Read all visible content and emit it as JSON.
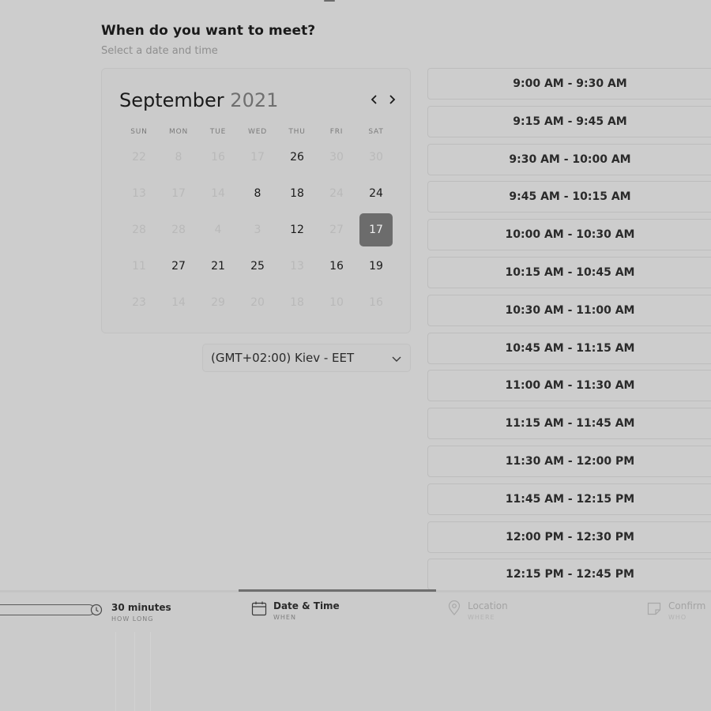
{
  "header": {
    "title": "When do you want to meet?",
    "subtitle": "Select a date and time"
  },
  "calendar": {
    "month": "September",
    "year": "2021",
    "prev_icon": "chevron-left-icon",
    "next_icon": "chevron-right-icon",
    "weekdays": [
      "SUN",
      "MON",
      "TUE",
      "WED",
      "THU",
      "FRI",
      "SAT"
    ],
    "weeks": [
      [
        {
          "d": "22",
          "s": "disabled"
        },
        {
          "d": "8",
          "s": "disabled"
        },
        {
          "d": "16",
          "s": "disabled"
        },
        {
          "d": "17",
          "s": "disabled"
        },
        {
          "d": "26",
          "s": "available"
        },
        {
          "d": "30",
          "s": "disabled"
        },
        {
          "d": "30",
          "s": "disabled"
        }
      ],
      [
        {
          "d": "13",
          "s": "disabled"
        },
        {
          "d": "17",
          "s": "disabled"
        },
        {
          "d": "14",
          "s": "disabled"
        },
        {
          "d": "8",
          "s": "available"
        },
        {
          "d": "18",
          "s": "available"
        },
        {
          "d": "24",
          "s": "disabled"
        },
        {
          "d": "24",
          "s": "available"
        }
      ],
      [
        {
          "d": "28",
          "s": "disabled"
        },
        {
          "d": "28",
          "s": "disabled"
        },
        {
          "d": "4",
          "s": "disabled"
        },
        {
          "d": "3",
          "s": "disabled"
        },
        {
          "d": "12",
          "s": "available"
        },
        {
          "d": "27",
          "s": "disabled"
        },
        {
          "d": "17",
          "s": "selected"
        }
      ],
      [
        {
          "d": "11",
          "s": "disabled"
        },
        {
          "d": "27",
          "s": "available"
        },
        {
          "d": "21",
          "s": "available"
        },
        {
          "d": "25",
          "s": "available"
        },
        {
          "d": "13",
          "s": "disabled"
        },
        {
          "d": "16",
          "s": "available"
        },
        {
          "d": "19",
          "s": "available"
        }
      ],
      [
        {
          "d": "23",
          "s": "disabled"
        },
        {
          "d": "14",
          "s": "disabled"
        },
        {
          "d": "29",
          "s": "disabled"
        },
        {
          "d": "20",
          "s": "disabled"
        },
        {
          "d": "18",
          "s": "disabled"
        },
        {
          "d": "10",
          "s": "disabled"
        },
        {
          "d": "16",
          "s": "disabled"
        }
      ]
    ],
    "selected_color": "#6c6c6c"
  },
  "timezone": {
    "value": "(GMT+02:00) Kiev - EET",
    "icon": "chevron-down-icon"
  },
  "time_slots": [
    "9:00 AM - 9:30 AM",
    "9:15 AM - 9:45 AM",
    "9:30 AM - 10:00 AM",
    "9:45 AM - 10:15 AM",
    "10:00 AM - 10:30 AM",
    "10:15 AM - 10:45 AM",
    "10:30 AM - 11:00 AM",
    "10:45 AM - 11:15 AM",
    "11:00 AM - 11:30 AM",
    "11:15 AM - 11:45 AM",
    "11:30 AM - 12:00 PM",
    "11:45 AM - 12:15 PM",
    "12:00 PM - 12:30 PM",
    "12:15 PM - 12:45 PM"
  ],
  "steps": {
    "duration": {
      "label": "30 minutes",
      "sub": "HOW LONG",
      "icon": "clock-icon"
    },
    "datetime": {
      "label": "Date & Time",
      "sub": "WHEN",
      "icon": "calendar-icon",
      "active": true
    },
    "location": {
      "label": "Location",
      "sub": "WHERE",
      "icon": "location-pin-icon"
    },
    "confirm": {
      "label": "Confirm",
      "sub": "WHO",
      "icon": "note-icon"
    }
  }
}
